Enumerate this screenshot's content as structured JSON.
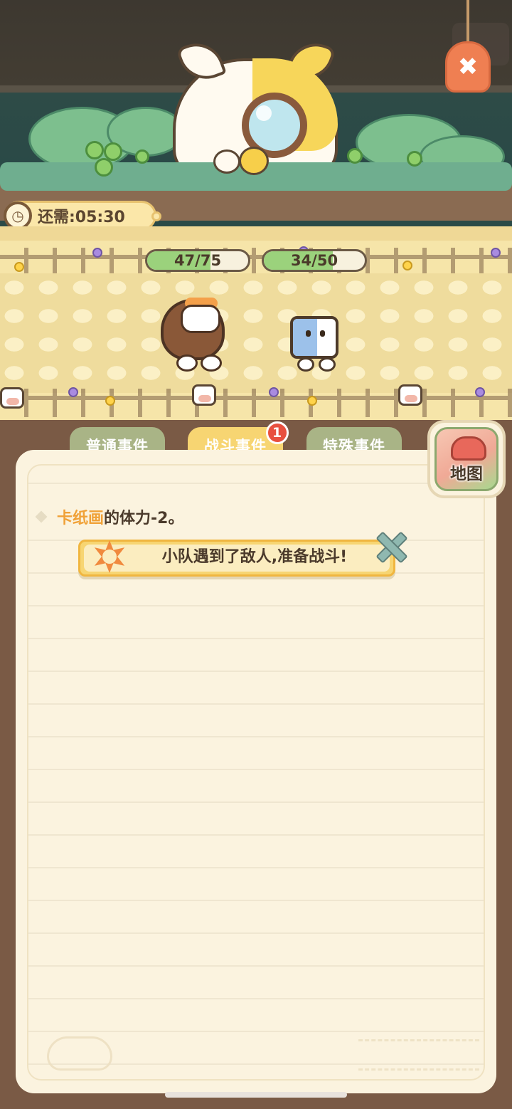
{
  "timer": {
    "label": "还需:05:30",
    "icon": "clock-icon"
  },
  "close_button": {
    "icon": "close-icon",
    "color": "#ef7f52"
  },
  "party": [
    {
      "name": "hero-cat",
      "hp_text": "47/75",
      "hp_fraction": 0.63
    },
    {
      "name": "ally-cat",
      "hp_text": "34/50",
      "hp_fraction": 0.68
    }
  ],
  "tabs": [
    {
      "label": "普通事件",
      "active": false
    },
    {
      "label": "战斗事件",
      "active": true,
      "badge": "1"
    },
    {
      "label": "特殊事件",
      "active": false
    }
  ],
  "map_button": {
    "label": "地图",
    "icon": "map-icon"
  },
  "log": {
    "entry_name": "卡纸画",
    "entry_text": "的体力-2。",
    "banner_text": "小队遇到了敌人,准备战斗!",
    "banner_icon": "paw-star-icon",
    "battle_icon": "crossed-swords-icon"
  },
  "colors": {
    "tab_inactive": "#a9b486",
    "tab_active": "#f7d572",
    "badge": "#e8503f",
    "highlight_name": "#f0a137",
    "hp_fill": "#9bd27c"
  }
}
